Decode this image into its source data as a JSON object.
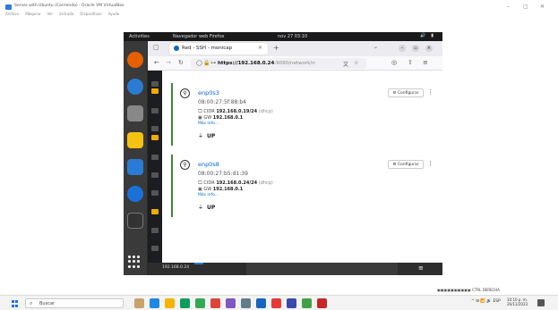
{
  "host": {
    "title": "Server with Ubuntu (Corriendo) - Oracle VM VirtualBox",
    "menu": [
      "Archivo",
      "Máquina",
      "Ver",
      "Entrada",
      "Dispositivos",
      "Ayuda"
    ],
    "controls": {
      "minimize": "–",
      "restore": "▢",
      "close": "✕"
    }
  },
  "gnome": {
    "activities": "Activities",
    "app_name": "Navegador web Firefox",
    "clock": "nov 27  03:10",
    "tray": "🔊 ▮"
  },
  "firefox": {
    "tab_title": "Red - SSH - monicap",
    "url_host": "https://192.168.0.24",
    "url_rest": ":9090/network/n",
    "new_tab": "+"
  },
  "interfaces": [
    {
      "name": "enp0s3",
      "mac": "08:00:27:5f:88:b4",
      "cidr_label": "CIDR",
      "cidr": "192.168.0.19/24",
      "cidr_mode": "(dhcp)",
      "gw_label": "GW",
      "gw": "192.168.0.1",
      "more": "Más info...",
      "state": "UP",
      "configure": "Configurar"
    },
    {
      "name": "enp0s8",
      "mac": "08:00:27:b5:d1:39",
      "cidr_label": "CIDR",
      "cidr": "192.168.0.24/24",
      "cidr_mode": "(dhcp)",
      "gw_label": "GW",
      "gw": "192.168.0.1",
      "more": "Más info...",
      "state": "UP",
      "configure": "Configurar"
    }
  ],
  "cockpit": {
    "host_label": "192.168.0.24"
  },
  "vbox_status": "CTRL DERECHA",
  "taskbar": {
    "search_placeholder": "Buscar",
    "tray": "ESP",
    "time": "10:10 p. m.",
    "date": "26/11/2023"
  },
  "colors": {
    "accent_blue": "#0066cc",
    "up_green": "#3e8635",
    "cockpit_dark": "#1b1d21"
  }
}
